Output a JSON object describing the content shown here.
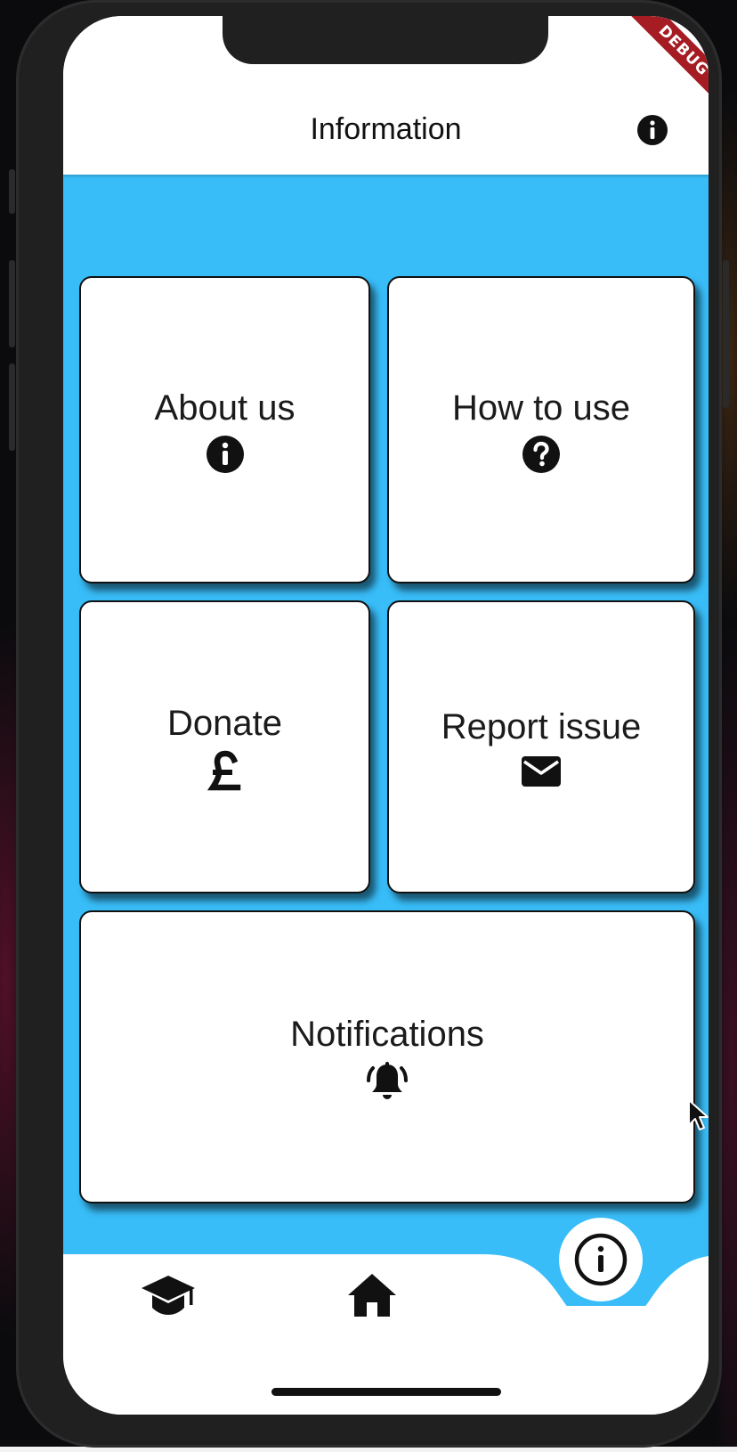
{
  "app_bar": {
    "title": "Information",
    "info_icon": "info-circle-icon"
  },
  "debug_banner": "DEBUG",
  "cards": [
    {
      "label": "About us",
      "icon": "info-circle-icon"
    },
    {
      "label": "How to use",
      "icon": "question-circle-icon"
    },
    {
      "label": "Donate",
      "icon": "pound-sign-icon"
    },
    {
      "label": "Report issue",
      "icon": "envelope-icon"
    },
    {
      "label": "Notifications",
      "icon": "bell-ringing-icon"
    }
  ],
  "bottom_nav": {
    "items": [
      {
        "icon": "graduation-cap-icon"
      },
      {
        "icon": "home-icon"
      },
      {
        "icon": "info-outline-icon",
        "active": true
      }
    ]
  },
  "colors": {
    "accent": "#38bdf8",
    "surface": "#ffffff",
    "ink": "#111111",
    "debug": "#a51c23"
  }
}
